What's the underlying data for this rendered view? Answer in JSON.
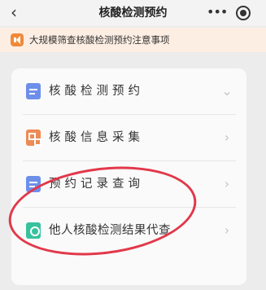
{
  "window": {
    "title": "核酸检测预约",
    "back_glyph": "‹",
    "more_glyph": "•••"
  },
  "notice": {
    "text": "大规模筛查核酸检测预约注意事项",
    "icon": "speaker-icon",
    "color": "#f08a3a"
  },
  "menu": {
    "items": [
      {
        "label": "核酸检测预约",
        "icon": "calendar-icon",
        "color": "#6d8fea",
        "chevron": "⌄"
      },
      {
        "label": "核酸信息采集",
        "icon": "qr-code-icon",
        "color": "#ee8a55",
        "chevron": "›"
      },
      {
        "label": "预约记录查询",
        "icon": "list-icon",
        "color": "#6d8fea",
        "chevron": "›"
      },
      {
        "label": "他人核酸检测结果代查",
        "icon": "search-report-icon",
        "color": "#37c29e",
        "chevron": "›"
      }
    ]
  },
  "annotation": {
    "color": "#e2384a"
  }
}
